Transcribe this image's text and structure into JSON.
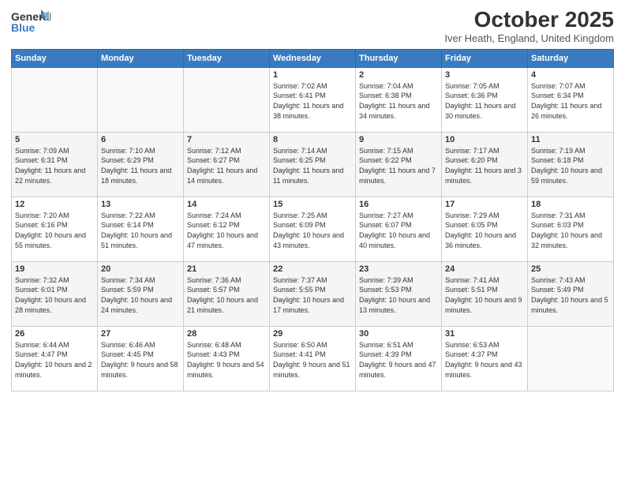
{
  "header": {
    "logo_general": "General",
    "logo_blue": "Blue",
    "month": "October 2025",
    "location": "Iver Heath, England, United Kingdom"
  },
  "days_of_week": [
    "Sunday",
    "Monday",
    "Tuesday",
    "Wednesday",
    "Thursday",
    "Friday",
    "Saturday"
  ],
  "weeks": [
    [
      {
        "day": "",
        "sunrise": "",
        "sunset": "",
        "daylight": ""
      },
      {
        "day": "",
        "sunrise": "",
        "sunset": "",
        "daylight": ""
      },
      {
        "day": "",
        "sunrise": "",
        "sunset": "",
        "daylight": ""
      },
      {
        "day": "1",
        "sunrise": "Sunrise: 7:02 AM",
        "sunset": "Sunset: 6:41 PM",
        "daylight": "Daylight: 11 hours and 38 minutes."
      },
      {
        "day": "2",
        "sunrise": "Sunrise: 7:04 AM",
        "sunset": "Sunset: 6:38 PM",
        "daylight": "Daylight: 11 hours and 34 minutes."
      },
      {
        "day": "3",
        "sunrise": "Sunrise: 7:05 AM",
        "sunset": "Sunset: 6:36 PM",
        "daylight": "Daylight: 11 hours and 30 minutes."
      },
      {
        "day": "4",
        "sunrise": "Sunrise: 7:07 AM",
        "sunset": "Sunset: 6:34 PM",
        "daylight": "Daylight: 11 hours and 26 minutes."
      }
    ],
    [
      {
        "day": "5",
        "sunrise": "Sunrise: 7:09 AM",
        "sunset": "Sunset: 6:31 PM",
        "daylight": "Daylight: 11 hours and 22 minutes."
      },
      {
        "day": "6",
        "sunrise": "Sunrise: 7:10 AM",
        "sunset": "Sunset: 6:29 PM",
        "daylight": "Daylight: 11 hours and 18 minutes."
      },
      {
        "day": "7",
        "sunrise": "Sunrise: 7:12 AM",
        "sunset": "Sunset: 6:27 PM",
        "daylight": "Daylight: 11 hours and 14 minutes."
      },
      {
        "day": "8",
        "sunrise": "Sunrise: 7:14 AM",
        "sunset": "Sunset: 6:25 PM",
        "daylight": "Daylight: 11 hours and 11 minutes."
      },
      {
        "day": "9",
        "sunrise": "Sunrise: 7:15 AM",
        "sunset": "Sunset: 6:22 PM",
        "daylight": "Daylight: 11 hours and 7 minutes."
      },
      {
        "day": "10",
        "sunrise": "Sunrise: 7:17 AM",
        "sunset": "Sunset: 6:20 PM",
        "daylight": "Daylight: 11 hours and 3 minutes."
      },
      {
        "day": "11",
        "sunrise": "Sunrise: 7:19 AM",
        "sunset": "Sunset: 6:18 PM",
        "daylight": "Daylight: 10 hours and 59 minutes."
      }
    ],
    [
      {
        "day": "12",
        "sunrise": "Sunrise: 7:20 AM",
        "sunset": "Sunset: 6:16 PM",
        "daylight": "Daylight: 10 hours and 55 minutes."
      },
      {
        "day": "13",
        "sunrise": "Sunrise: 7:22 AM",
        "sunset": "Sunset: 6:14 PM",
        "daylight": "Daylight: 10 hours and 51 minutes."
      },
      {
        "day": "14",
        "sunrise": "Sunrise: 7:24 AM",
        "sunset": "Sunset: 6:12 PM",
        "daylight": "Daylight: 10 hours and 47 minutes."
      },
      {
        "day": "15",
        "sunrise": "Sunrise: 7:25 AM",
        "sunset": "Sunset: 6:09 PM",
        "daylight": "Daylight: 10 hours and 43 minutes."
      },
      {
        "day": "16",
        "sunrise": "Sunrise: 7:27 AM",
        "sunset": "Sunset: 6:07 PM",
        "daylight": "Daylight: 10 hours and 40 minutes."
      },
      {
        "day": "17",
        "sunrise": "Sunrise: 7:29 AM",
        "sunset": "Sunset: 6:05 PM",
        "daylight": "Daylight: 10 hours and 36 minutes."
      },
      {
        "day": "18",
        "sunrise": "Sunrise: 7:31 AM",
        "sunset": "Sunset: 6:03 PM",
        "daylight": "Daylight: 10 hours and 32 minutes."
      }
    ],
    [
      {
        "day": "19",
        "sunrise": "Sunrise: 7:32 AM",
        "sunset": "Sunset: 6:01 PM",
        "daylight": "Daylight: 10 hours and 28 minutes."
      },
      {
        "day": "20",
        "sunrise": "Sunrise: 7:34 AM",
        "sunset": "Sunset: 5:59 PM",
        "daylight": "Daylight: 10 hours and 24 minutes."
      },
      {
        "day": "21",
        "sunrise": "Sunrise: 7:36 AM",
        "sunset": "Sunset: 5:57 PM",
        "daylight": "Daylight: 10 hours and 21 minutes."
      },
      {
        "day": "22",
        "sunrise": "Sunrise: 7:37 AM",
        "sunset": "Sunset: 5:55 PM",
        "daylight": "Daylight: 10 hours and 17 minutes."
      },
      {
        "day": "23",
        "sunrise": "Sunrise: 7:39 AM",
        "sunset": "Sunset: 5:53 PM",
        "daylight": "Daylight: 10 hours and 13 minutes."
      },
      {
        "day": "24",
        "sunrise": "Sunrise: 7:41 AM",
        "sunset": "Sunset: 5:51 PM",
        "daylight": "Daylight: 10 hours and 9 minutes."
      },
      {
        "day": "25",
        "sunrise": "Sunrise: 7:43 AM",
        "sunset": "Sunset: 5:49 PM",
        "daylight": "Daylight: 10 hours and 5 minutes."
      }
    ],
    [
      {
        "day": "26",
        "sunrise": "Sunrise: 6:44 AM",
        "sunset": "Sunset: 4:47 PM",
        "daylight": "Daylight: 10 hours and 2 minutes."
      },
      {
        "day": "27",
        "sunrise": "Sunrise: 6:46 AM",
        "sunset": "Sunset: 4:45 PM",
        "daylight": "Daylight: 9 hours and 58 minutes."
      },
      {
        "day": "28",
        "sunrise": "Sunrise: 6:48 AM",
        "sunset": "Sunset: 4:43 PM",
        "daylight": "Daylight: 9 hours and 54 minutes."
      },
      {
        "day": "29",
        "sunrise": "Sunrise: 6:50 AM",
        "sunset": "Sunset: 4:41 PM",
        "daylight": "Daylight: 9 hours and 51 minutes."
      },
      {
        "day": "30",
        "sunrise": "Sunrise: 6:51 AM",
        "sunset": "Sunset: 4:39 PM",
        "daylight": "Daylight: 9 hours and 47 minutes."
      },
      {
        "day": "31",
        "sunrise": "Sunrise: 6:53 AM",
        "sunset": "Sunset: 4:37 PM",
        "daylight": "Daylight: 9 hours and 43 minutes."
      },
      {
        "day": "",
        "sunrise": "",
        "sunset": "",
        "daylight": ""
      }
    ]
  ]
}
